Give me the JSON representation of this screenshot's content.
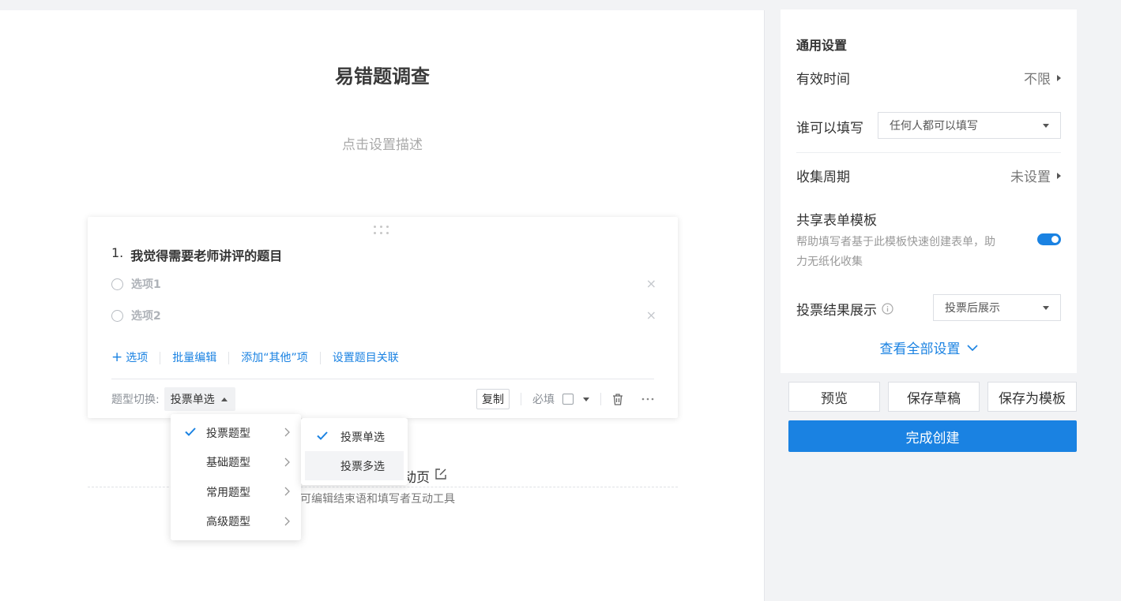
{
  "form": {
    "title": "易错题调查",
    "description_placeholder": "点击设置描述"
  },
  "question": {
    "number": "1.",
    "title": "我觉得需要老师讲评的题目",
    "options": [
      {
        "label": "选项1"
      },
      {
        "label": "选项2"
      }
    ],
    "close_glyph": "×",
    "actions": {
      "add_option": "选项",
      "batch_edit": "批量编辑",
      "add_other": "添加“其他”项",
      "set_relation": "设置题目关联"
    },
    "footer": {
      "type_switch_label": "题型切换:",
      "type_switch_value": "投票单选",
      "copy": "复制",
      "required": "必填"
    }
  },
  "type_menu": {
    "items": [
      {
        "label": "投票题型",
        "checked": true
      },
      {
        "label": "基础题型",
        "checked": false
      },
      {
        "label": "常用题型",
        "checked": false
      },
      {
        "label": "高级题型",
        "checked": false
      }
    ]
  },
  "sub_menu": {
    "items": [
      {
        "label": "投票单选",
        "checked": true
      },
      {
        "label": "投票多选",
        "checked": false
      }
    ]
  },
  "end_page": {
    "title": "动页",
    "description": "可编辑结束语和填写者互动工具"
  },
  "settings": {
    "heading": "通用设置",
    "valid_time": {
      "label": "有效时间",
      "value": "不限"
    },
    "who_can_fill": {
      "label": "谁可以填写",
      "value": "任何人都可以填写"
    },
    "collect_cycle": {
      "label": "收集周期",
      "value": "未设置"
    },
    "share_template": {
      "label": "共享表单模板",
      "description": "帮助填写者基于此模板快速创建表单，助力无纸化收集",
      "enabled": true
    },
    "vote_result": {
      "label": "投票结果展示",
      "value": "投票后展示"
    },
    "view_all": "查看全部设置"
  },
  "buttons": {
    "preview": "预览",
    "save_draft": "保存草稿",
    "save_template": "保存为模板",
    "finish": "完成创建"
  },
  "colors": {
    "accent": "#1a82e2",
    "background": "#f2f3f5"
  },
  "icons": [
    "drag-handle-icon",
    "radio-icon",
    "close-icon",
    "plus-icon",
    "caret-up-icon",
    "caret-down-icon",
    "trash-icon",
    "more-icon",
    "check-icon",
    "chevron-right-icon",
    "edit-icon",
    "triangle-right-icon",
    "info-icon",
    "chevron-down-icon"
  ]
}
